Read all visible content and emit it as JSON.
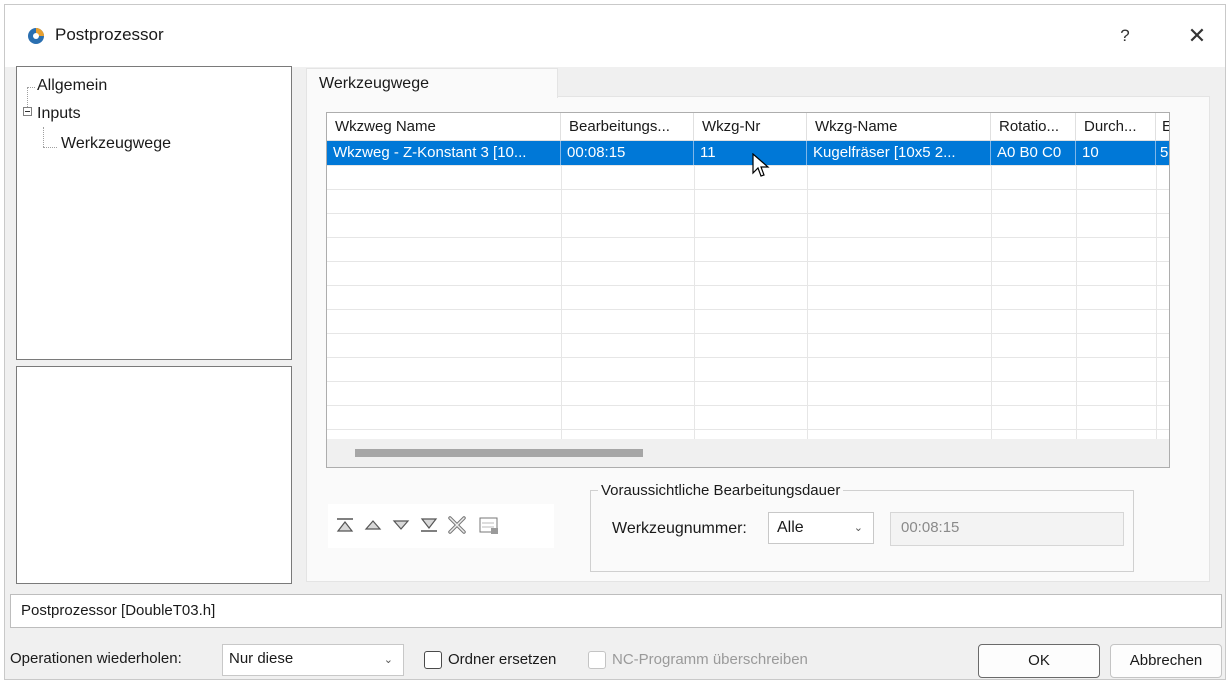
{
  "window": {
    "title": "Postprozessor",
    "help_label": "?",
    "close_label": "✕"
  },
  "tree": {
    "items": [
      {
        "label": "Allgemein"
      },
      {
        "label": "Inputs"
      },
      {
        "label": "Werkzeugwege"
      }
    ]
  },
  "tab": {
    "label": "Werkzeugwege"
  },
  "grid": {
    "columns": [
      "Wkzweg Name",
      "Bearbeitungs...",
      "Wkzg-Nr",
      "Wkzg-Name",
      "Rotatio...",
      "Durch...",
      "E"
    ],
    "rows": [
      [
        "Wkzweg - Z-Konstant 3 [10...",
        "00:08:15",
        "11",
        "Kugelfräser [10x5 2...",
        "A0 B0 C0",
        "10",
        "5"
      ]
    ]
  },
  "toolbar": {
    "icons": [
      "move-top-icon",
      "move-up-icon",
      "move-down-icon",
      "move-bottom-icon",
      "delete-icon",
      "properties-icon"
    ]
  },
  "duration_group": {
    "title": "Voraussichtliche Bearbeitungsdauer",
    "tool_number_label": "Werkzeugnummer:",
    "tool_number_value": "Alle",
    "duration_value": "00:08:15"
  },
  "status": {
    "text": "Postprozessor [DoubleT03.h]"
  },
  "bottom": {
    "repeat_label": "Operationen wiederholen:",
    "repeat_value": "Nur diese",
    "replace_folder_label": "Ordner ersetzen",
    "overwrite_nc_label": "NC-Programm überschreiben",
    "ok_label": "OK",
    "cancel_label": "Abbrechen"
  },
  "colors": {
    "selection": "#0078d7",
    "background": "#f0f0f0"
  }
}
